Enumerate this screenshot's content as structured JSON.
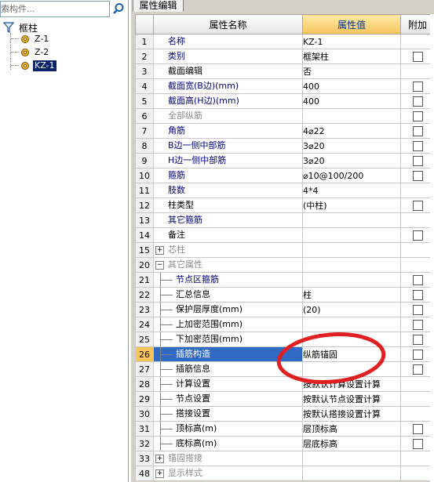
{
  "search": {
    "value": "索构件..."
  },
  "tree": {
    "root_label": "框柱",
    "children": [
      "Z-1",
      "Z-2",
      "KZ-1"
    ]
  },
  "panel": {
    "tab_label": "属性编辑"
  },
  "table": {
    "headers": {
      "name": "属性名称",
      "value": "属性值",
      "attach": "附加"
    },
    "rows": [
      {
        "num": "1",
        "name": "名称",
        "value": "KZ-1",
        "checkbox": false
      },
      {
        "num": "2",
        "name": "类别",
        "value": "框架柱",
        "checkbox": true
      },
      {
        "num": "3",
        "name": "截面编辑",
        "value": "否",
        "checkbox": false
      },
      {
        "num": "4",
        "name": "截面宽(B边)(mm)",
        "value": "400",
        "checkbox": true
      },
      {
        "num": "5",
        "name": "截面高(H边)(mm)",
        "value": "400",
        "checkbox": true
      },
      {
        "num": "6",
        "name": "全部纵筋",
        "value": "",
        "checkbox": true
      },
      {
        "num": "7",
        "name": "角筋",
        "value": "4⌀22",
        "checkbox": true
      },
      {
        "num": "8",
        "name": "B边一侧中部筋",
        "value": "3⌀20",
        "checkbox": true
      },
      {
        "num": "9",
        "name": "H边一侧中部筋",
        "value": "3⌀20",
        "checkbox": true
      },
      {
        "num": "10",
        "name": "箍筋",
        "value": "⌀10@100/200",
        "checkbox": true
      },
      {
        "num": "11",
        "name": "肢数",
        "value": "4*4",
        "checkbox": false
      },
      {
        "num": "12",
        "name": "柱类型",
        "value": "(中柱)",
        "checkbox": true
      },
      {
        "num": "13",
        "name": "其它箍筋",
        "value": "",
        "checkbox": false
      },
      {
        "num": "14",
        "name": "备注",
        "value": "",
        "checkbox": true
      },
      {
        "num": "15",
        "name": "芯柱",
        "value": "",
        "checkbox": false,
        "expander": "+"
      },
      {
        "num": "20",
        "name": "其它属性",
        "value": "",
        "checkbox": false,
        "expander": "−"
      },
      {
        "num": "21",
        "name": "节点区箍筋",
        "value": "",
        "checkbox": true,
        "leaf": true
      },
      {
        "num": "22",
        "name": "汇总信息",
        "value": "柱",
        "checkbox": true,
        "leaf": true
      },
      {
        "num": "23",
        "name": "保护层厚度(mm)",
        "value": "(20)",
        "checkbox": true,
        "leaf": true
      },
      {
        "num": "24",
        "name": "上加密范围(mm)",
        "value": "",
        "checkbox": true,
        "leaf": true
      },
      {
        "num": "25",
        "name": "下加密范围(mm)",
        "value": "",
        "checkbox": true,
        "leaf": true
      },
      {
        "num": "26",
        "name": "插筋构造",
        "value": "纵筋锚固",
        "checkbox": true,
        "leaf": true,
        "current": true
      },
      {
        "num": "27",
        "name": "插筋信息",
        "value": "",
        "checkbox": true,
        "leaf": true
      },
      {
        "num": "28",
        "name": "计算设置",
        "value": "按默认计算设置计算",
        "checkbox": false,
        "leaf": true
      },
      {
        "num": "29",
        "name": "节点设置",
        "value": "按默认节点设置计算",
        "checkbox": false,
        "leaf": true
      },
      {
        "num": "30",
        "name": "搭接设置",
        "value": "按默认搭接设置计算",
        "checkbox": false,
        "leaf": true
      },
      {
        "num": "31",
        "name": "顶标高(m)",
        "value": "层顶标高",
        "checkbox": true,
        "leaf": true
      },
      {
        "num": "32",
        "name": "底标高(m)",
        "value": "层底标高",
        "checkbox": true,
        "leaf": true
      },
      {
        "num": "33",
        "name": "锚固搭接",
        "value": "",
        "checkbox": false,
        "expander": "+"
      },
      {
        "num": "48",
        "name": "显示样式",
        "value": "",
        "checkbox": false,
        "expander": "+"
      }
    ]
  },
  "colors": {
    "link_text": "#00007f",
    "gray_text": "#8c8c8c",
    "selection": "#316ac5",
    "header_accent": "#f7c45a",
    "annotation_ellipse": "#e02020"
  }
}
